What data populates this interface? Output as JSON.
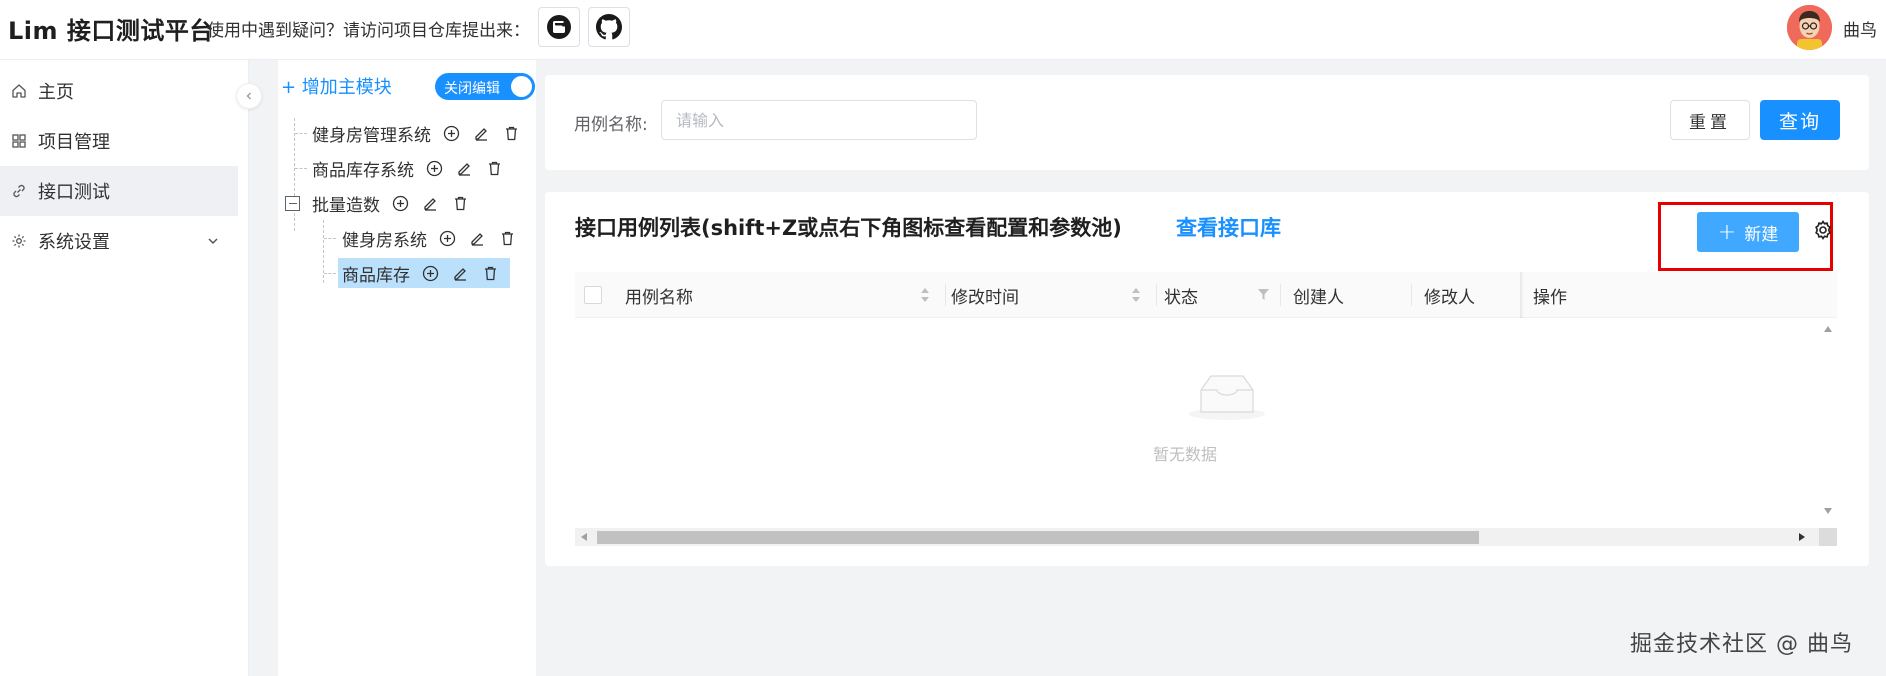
{
  "header": {
    "logo": "Lim 接口测试平台",
    "tagline": "使用中遇到疑问？请访问项目仓库提出来：",
    "buttons": [
      {
        "icon": "gitee-icon"
      },
      {
        "icon": "github-icon"
      }
    ],
    "username": "曲鸟"
  },
  "sidebar": {
    "items": [
      {
        "label": "主页",
        "icon": "home-icon"
      },
      {
        "label": "项目管理",
        "icon": "grid-icon"
      },
      {
        "label": "接口测试",
        "icon": "link-icon",
        "active": true
      },
      {
        "label": "系统设置",
        "icon": "gear-icon",
        "expandable": true
      }
    ]
  },
  "tree": {
    "add_label": "+ 增加主模块",
    "toggle_label": "关闭编辑",
    "toggle_on": true,
    "nodes": [
      {
        "label": "健身房管理系统",
        "level": 1
      },
      {
        "label": "商品库存系统",
        "level": 1
      },
      {
        "label": "批量造数",
        "level": 1,
        "expanded": true
      },
      {
        "label": "健身房系统",
        "level": 2
      },
      {
        "label": "商品库存",
        "level": 2,
        "selected": true
      }
    ]
  },
  "search": {
    "label": "用例名称:",
    "placeholder": "请输入",
    "value": "",
    "reset_label": "重置",
    "query_label": "查询"
  },
  "list": {
    "title": "接口用例列表(shift+Z或点右下角图标查看配置和参数池)",
    "link": "查看接口库",
    "new_label": "新建",
    "columns": [
      "用例名称",
      "修改时间",
      "状态",
      "创建人",
      "修改人",
      "操作"
    ],
    "empty_text": "暂无数据",
    "accent": "#1890ff",
    "highlight_color": "#e60000"
  },
  "watermark": "掘金技术社区 @ 曲鸟"
}
